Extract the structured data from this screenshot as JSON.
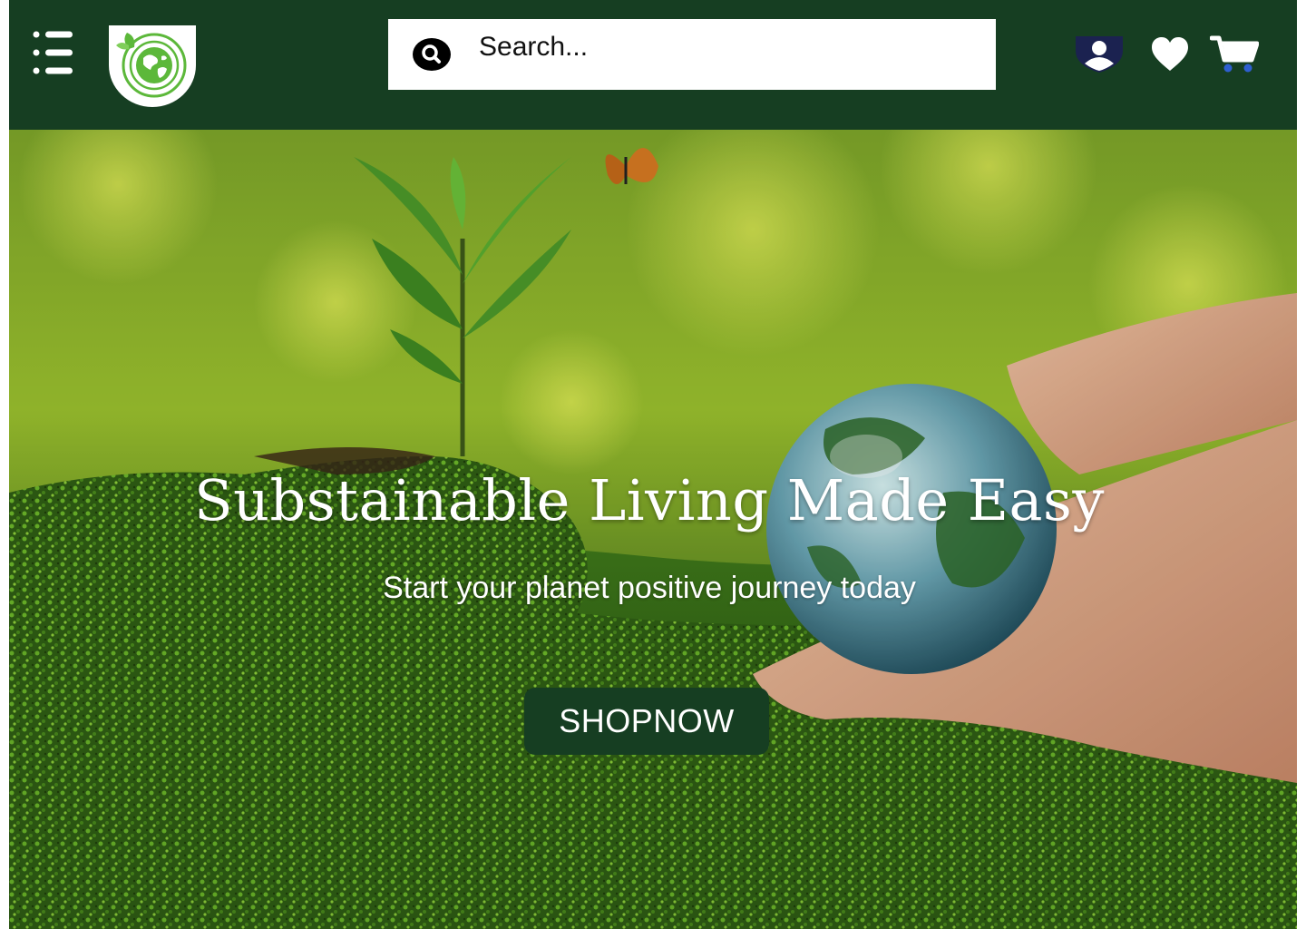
{
  "header": {
    "search": {
      "placeholder": "Search..."
    },
    "icons": {
      "menu": "menu-list-icon",
      "logo": "globe-leaf-logo",
      "search": "search-icon",
      "account": "user-shield-icon",
      "wishlist": "heart-icon",
      "cart": "cart-icon"
    }
  },
  "hero": {
    "title": "Substainable Living Made Easy",
    "subtitle": "Start your planet positive journey today",
    "cta_label": "SHOPNOW"
  },
  "colors": {
    "brand_dark_green": "#163e22",
    "accent_green": "#5cb83a",
    "cart_wheels_blue": "#2e5fd0",
    "account_shield_navy": "#1b2250"
  }
}
